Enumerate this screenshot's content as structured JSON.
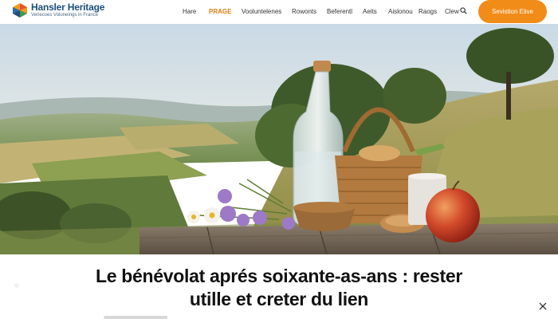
{
  "header": {
    "logo_title": "Hansler Heritage",
    "logo_subtitle": "Veriecoes Voluneings in France",
    "nav": [
      {
        "label": "Hare",
        "active": false
      },
      {
        "label": "PRAGE",
        "active": true
      },
      {
        "label": "Vooluntelenes",
        "active": false
      },
      {
        "label": "Rowonts",
        "active": false
      },
      {
        "label": "Beferentl",
        "active": false
      },
      {
        "label": "Aeits",
        "active": false
      },
      {
        "label": "Aislonou",
        "active": false
      },
      {
        "label": "Raogs",
        "active": false
      },
      {
        "label": "Clew",
        "active": false
      }
    ],
    "search_icon": "search-icon",
    "cta_label": "Sevistion Eiive",
    "accent": "#f28c18"
  },
  "hero": {
    "alt_subject": "picnic-still-life",
    "icon": "hero-image"
  },
  "article": {
    "title_line1": "Le bénévolat aprés soixante-as-ans : rester",
    "title_line2": "utille et creter du lien"
  },
  "close_icon": "close-icon"
}
